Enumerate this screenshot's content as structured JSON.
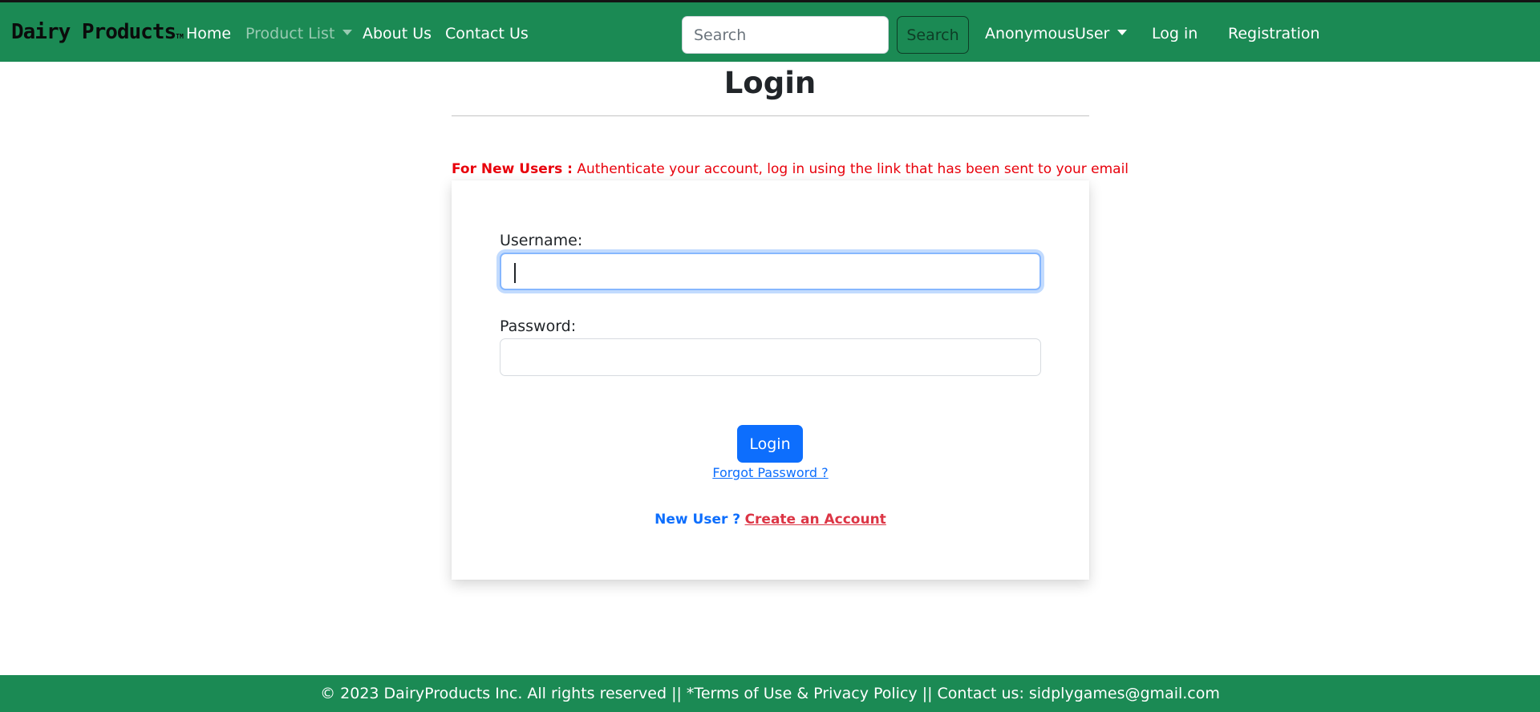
{
  "navbar": {
    "brand": "Dairy Products",
    "brand_tm": "TM",
    "links": {
      "home": "Home",
      "product_list": "Product List",
      "about": "About Us",
      "contact": "Contact Us"
    },
    "search": {
      "placeholder": "Search",
      "value": "",
      "button_label": "Search"
    },
    "user_menu": "AnonymousUser",
    "login": "Log in",
    "registration": "Registration",
    "background_color": "#1b8a54"
  },
  "main": {
    "title": "Login",
    "notice": {
      "label": "For New Users :",
      "text": "Authenticate your account, log in using the link that has been sent to your email"
    },
    "form": {
      "username_label": "Username:",
      "username_value": "",
      "password_label": "Password:",
      "password_value": "",
      "login_button": "Login",
      "forgot_password": "Forgot Password ?",
      "new_user_label": "New User ?",
      "create_account": "Create an Account"
    }
  },
  "footer": {
    "text": "© 2023 DairyProducts Inc. All rights reserved || *Terms of Use & Privacy Policy || Contact us: sidplygames@gmail.com",
    "background_color": "#1b8a54"
  },
  "colors": {
    "primary": "#0d6efd",
    "danger": "#dc3545",
    "notice_red": "#e8000b"
  }
}
